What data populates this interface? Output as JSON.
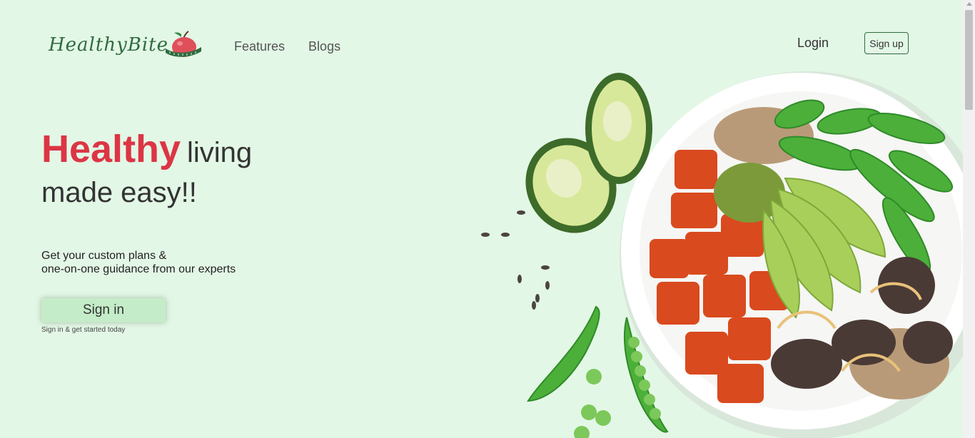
{
  "brand": {
    "name": "HealthyBite"
  },
  "nav": {
    "features": "Features",
    "blogs": "Blogs"
  },
  "auth": {
    "login": "Login",
    "signup": "Sign up"
  },
  "hero": {
    "title_strong": "Healthy",
    "title_rest": "living",
    "title_line2": "made easy!!",
    "subtitle_line1": "Get your custom plans &",
    "subtitle_line2": "one-on-one guidance from our experts",
    "cta": "Sign in",
    "cta_hint": "Sign in & get started today"
  },
  "colors": {
    "background": "#e3f7e6",
    "accent": "#dc3545",
    "brand_green": "#2e6b3f",
    "button_green": "#c5ecc8"
  },
  "icons": {
    "logo_mark": "apple-measuring-tape-icon",
    "hero_image": "food-bowl-image"
  }
}
